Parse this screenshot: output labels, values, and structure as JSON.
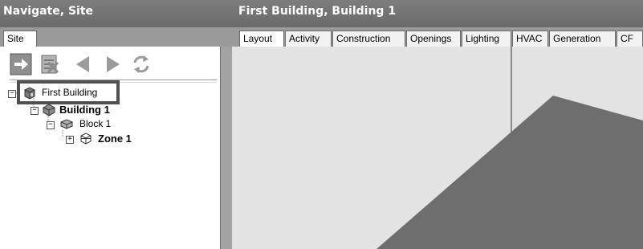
{
  "left_title": "Navigate, Site",
  "right_title": "First Building, Building 1",
  "site_tab": "Site",
  "tabs": [
    "Layout",
    "Activity",
    "Construction",
    "Openings",
    "Lighting",
    "HVAC",
    "Generation",
    "CF"
  ],
  "active_tab": "Layout",
  "toolbar_icons": [
    "go-arrow-icon",
    "delete-icon",
    "back-icon",
    "forward-icon",
    "refresh-icon"
  ],
  "tree": {
    "site_node": "First Building",
    "building": "Building 1",
    "block": "Block 1",
    "zone": "Zone 1"
  },
  "colors": {
    "title_bar": "#737373",
    "viewport_bg": "#e3e3e3",
    "model_fill": "#6e6e6e",
    "accent_button": "#8f8f8f"
  }
}
